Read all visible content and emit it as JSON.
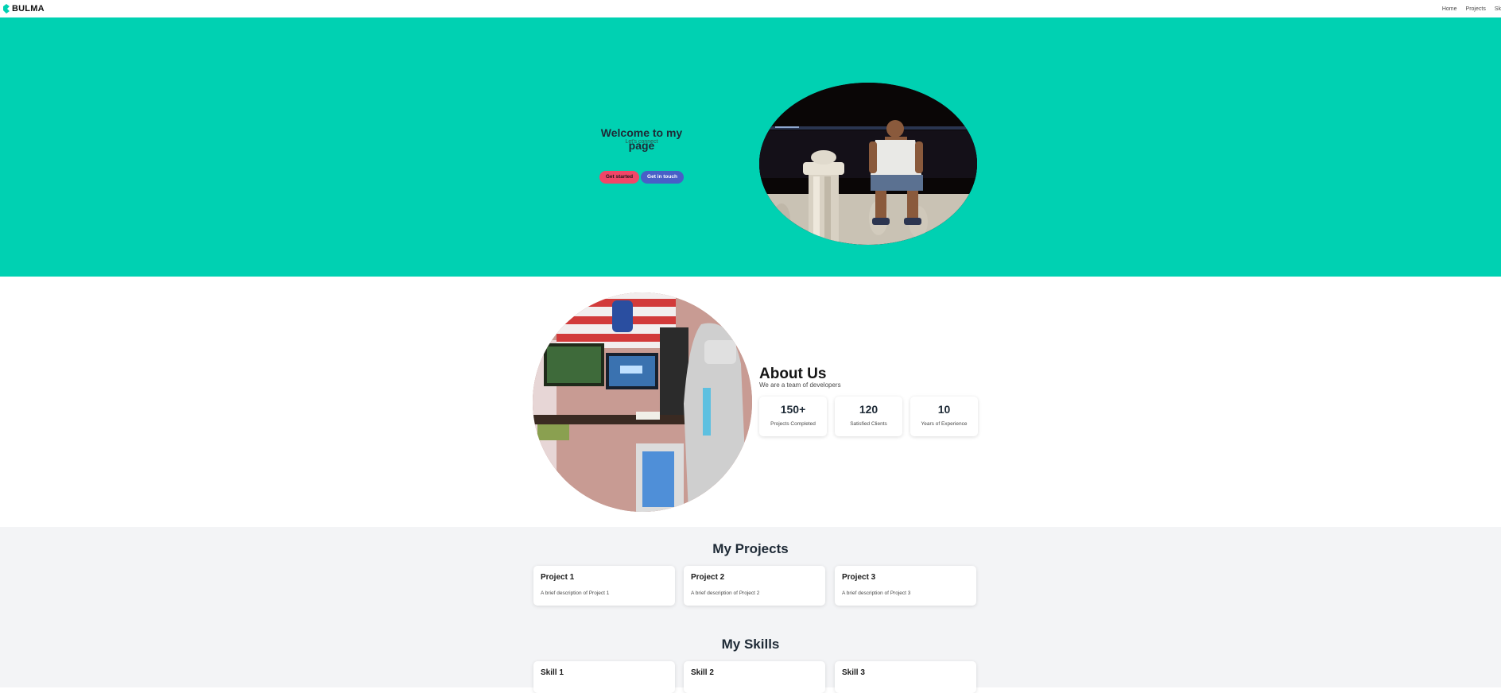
{
  "navbar": {
    "brand": "BULMA",
    "brand_icon": "bulma-logo-icon",
    "links": [
      "Home",
      "Projects",
      "Sk"
    ]
  },
  "hero": {
    "title": "Welcome to my page",
    "subtitle": "Let's connect",
    "btn_start": "Get started",
    "btn_touch": "Get in touch",
    "background": "#00d1b2"
  },
  "about": {
    "title": "About Us",
    "subtitle": "We are a team of developers",
    "stats": [
      {
        "value": "150+",
        "label": "Projects Completed"
      },
      {
        "value": "120",
        "label": "Satisfied Clients"
      },
      {
        "value": "10",
        "label": "Years of Experience"
      }
    ]
  },
  "projects": {
    "title": "My Projects",
    "items": [
      {
        "title": "Project 1",
        "desc": "A brief description of Project 1"
      },
      {
        "title": "Project 2",
        "desc": "A brief description of Project 2"
      },
      {
        "title": "Project 3",
        "desc": "A brief description of Project 3"
      }
    ]
  },
  "skills": {
    "title": "My Skills",
    "items": [
      {
        "title": "Skill 1"
      },
      {
        "title": "Skill 2"
      },
      {
        "title": "Skill 3"
      }
    ]
  },
  "colors": {
    "primary": "#00d1b2",
    "danger": "#f14668",
    "link": "#485fc7",
    "light_bg": "#f3f4f6"
  }
}
